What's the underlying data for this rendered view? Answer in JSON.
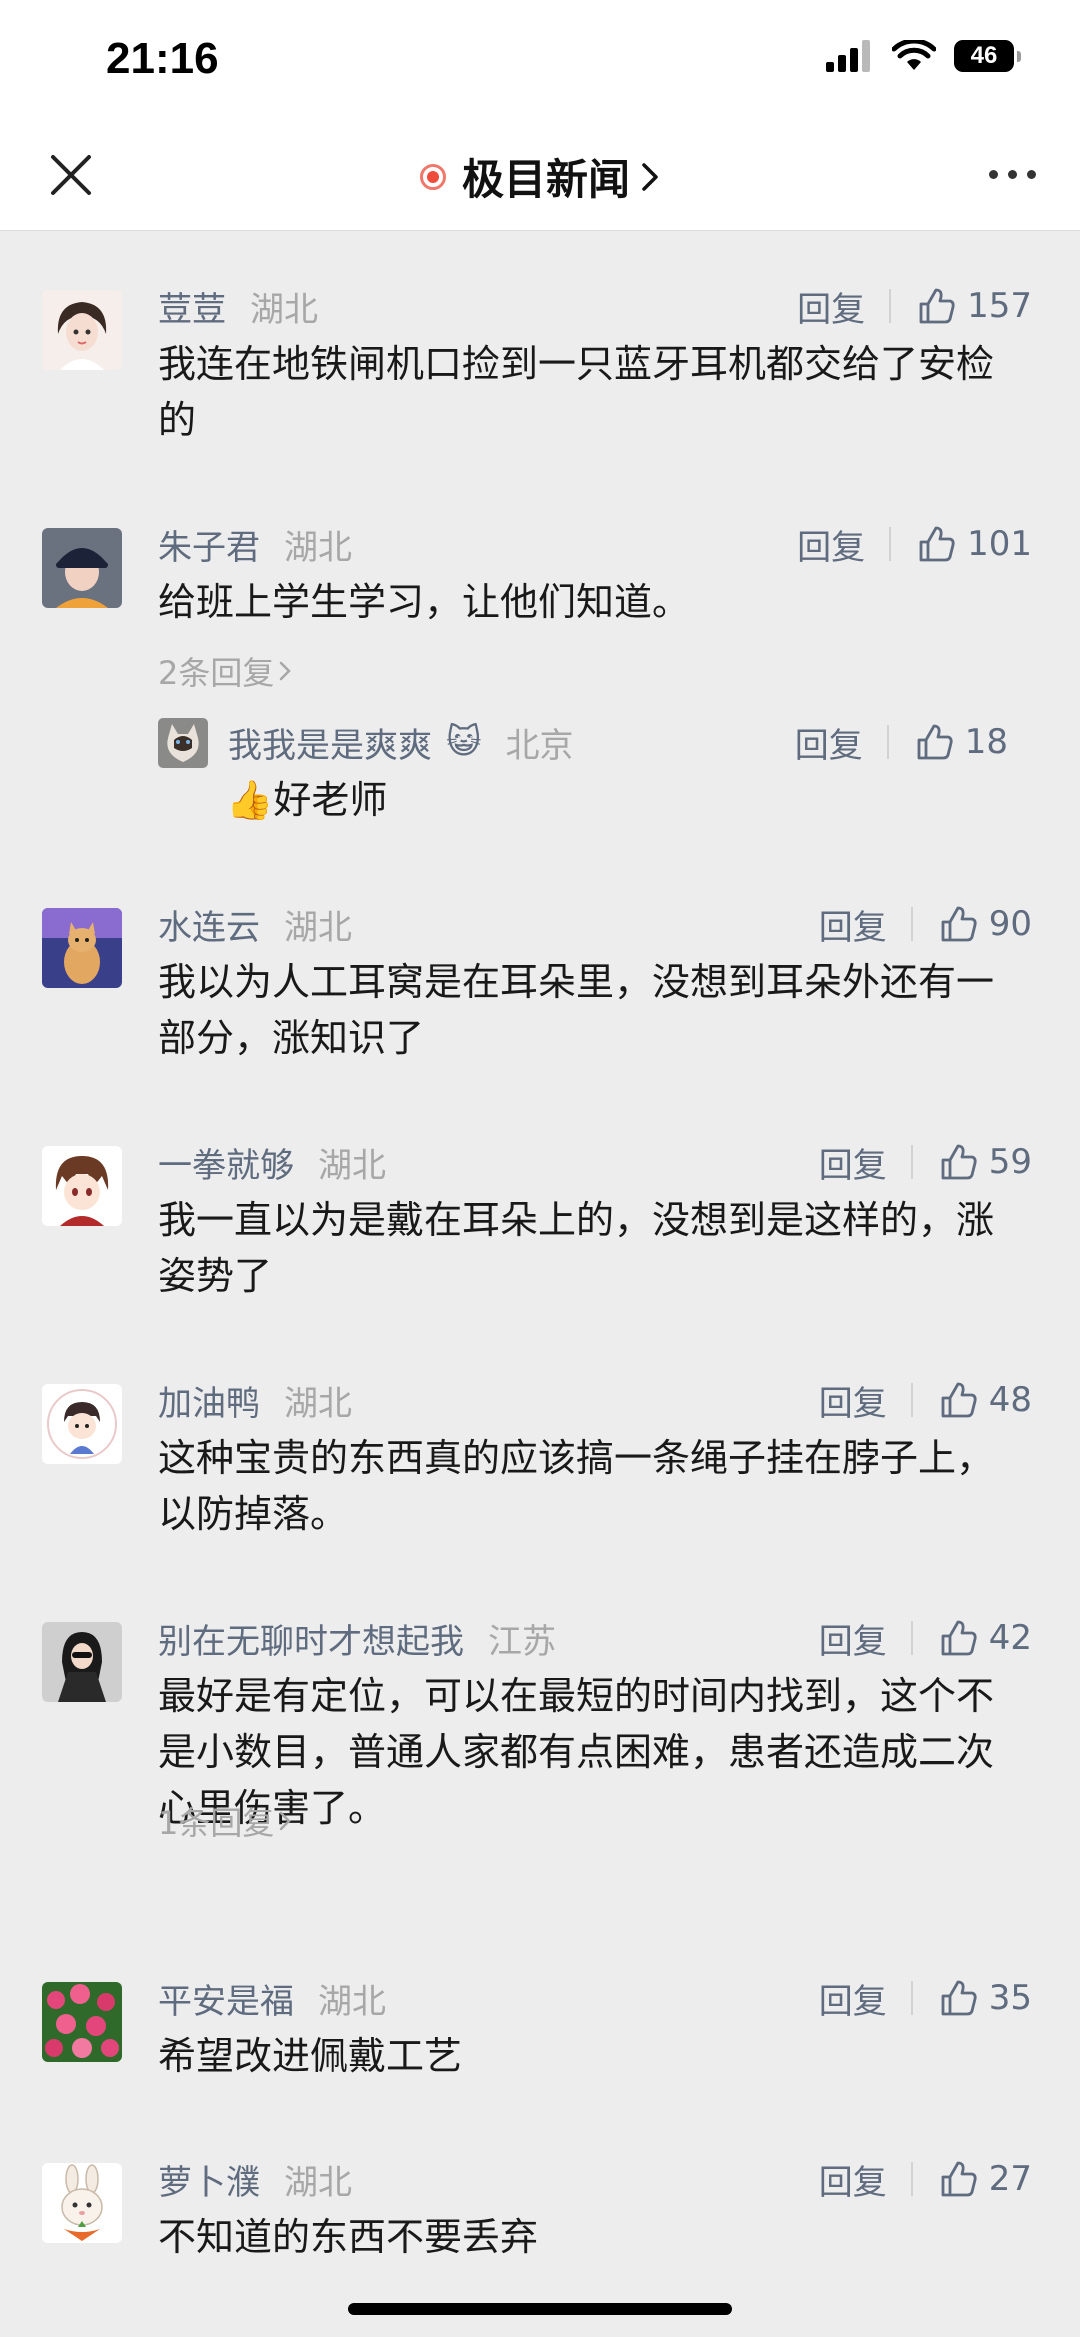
{
  "status": {
    "time": "21:16",
    "battery": "46"
  },
  "nav": {
    "title": "极目新闻"
  },
  "comments": [
    {
      "name": "荳荳",
      "region": "湖北",
      "reply": "回复",
      "likes": "157",
      "text": "我连在地铁闸机口捡到一只蓝牙耳机都交给了安检的",
      "avatar": "avatar-girl"
    },
    {
      "name": "朱子君",
      "region": "湖北",
      "reply": "回复",
      "likes": "101",
      "text": "给班上学生学习，让他们知道。",
      "more": "2条回复",
      "avatar": "avatar-cap",
      "sub": {
        "name": "我我是是爽爽",
        "emoji": "😺",
        "region": "北京",
        "reply": "回复",
        "likes": "18",
        "text": "好老师",
        "emoji_text": "👍"
      }
    },
    {
      "name": "水连云",
      "region": "湖北",
      "reply": "回复",
      "likes": "90",
      "text": "我以为人工耳窝是在耳朵里，没想到耳朵外还有一部分，涨知识了",
      "avatar": "avatar-cat"
    },
    {
      "name": "一拳就够",
      "region": "湖北",
      "reply": "回复",
      "likes": "59",
      "text": "我一直以为是戴在耳朵上的，没想到是这样的，涨姿势了",
      "avatar": "avatar-anime"
    },
    {
      "name": "加油鸭",
      "region": "湖北",
      "reply": "回复",
      "likes": "48",
      "text": "这种宝贵的东西真的应该搞一条绳子挂在脖子上，以防掉落。",
      "avatar": "avatar-cartoon"
    },
    {
      "name": "别在无聊时才想起我",
      "region": "江苏",
      "reply": "回复",
      "likes": "42",
      "text": "最好是有定位，可以在最短的时间内找到，这个不是小数目，普通人家都有点困难，患者还造成二次心里伤害了。",
      "more": "1条回复",
      "avatar": "avatar-photo"
    },
    {
      "name": "平安是福",
      "region": "湖北",
      "reply": "回复",
      "likes": "35",
      "text": "希望改进佩戴工艺",
      "avatar": "avatar-flowers"
    },
    {
      "name": "萝卜濮",
      "region": "湖北",
      "reply": "回复",
      "likes": "27",
      "text": "不知道的东西不要丢弃",
      "avatar": "avatar-rabbit"
    }
  ],
  "colors": {
    "name": "#5f6b7e",
    "region": "#a7a7a7",
    "text": "#191919",
    "background": "#ededed"
  }
}
